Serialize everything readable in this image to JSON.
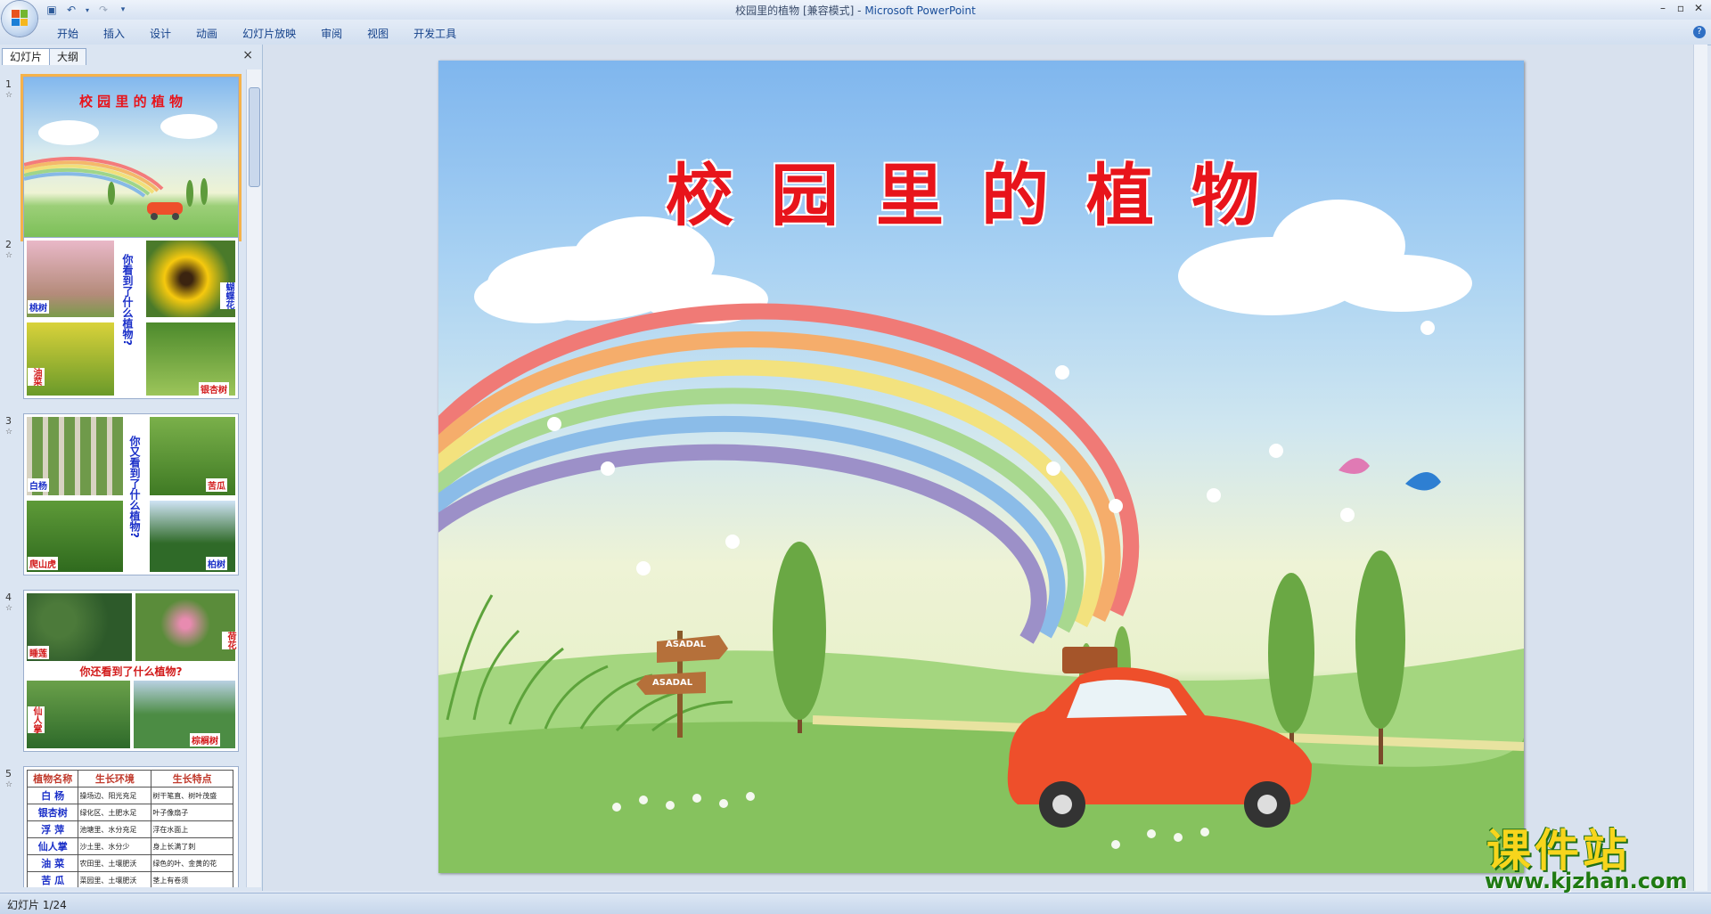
{
  "window": {
    "title": "校园里的植物 [兼容模式]",
    "separator": " - ",
    "app_name": "Microsoft PowerPoint"
  },
  "ribbon": {
    "tabs": [
      "开始",
      "插入",
      "设计",
      "动画",
      "幻灯片放映",
      "审阅",
      "视图",
      "开发工具"
    ]
  },
  "panel": {
    "tabs": [
      "幻灯片",
      "大纲"
    ],
    "close": "×"
  },
  "thumbnails": [
    {
      "num": "1",
      "title": "校 园 里 的 植 物"
    },
    {
      "num": "2",
      "question": "你看到了什么植物?",
      "labels": [
        "桃树",
        "蝴蝶花",
        "油菜",
        "银杏树"
      ]
    },
    {
      "num": "3",
      "question": "你又看到了什么植物?",
      "labels": [
        "白杨",
        "苦瓜",
        "爬山虎",
        "柏树"
      ]
    },
    {
      "num": "4",
      "question": "你还看到了什么植物?",
      "labels": [
        "睡莲",
        "荷花",
        "仙人掌",
        "棕榈树"
      ]
    },
    {
      "num": "5",
      "table_headers": [
        "植物名称",
        "生长环境",
        "生长特点"
      ],
      "table_rows": [
        [
          "白 杨",
          "操场边、阳光充足",
          "树干笔直、树叶茂盛"
        ],
        [
          "银杏树",
          "绿化区、土肥水足",
          "叶子像扇子"
        ],
        [
          "浮 萍",
          "池塘里、水分充足",
          "浮在水面上"
        ],
        [
          "仙人掌",
          "沙土里、水分少",
          "身上长满了刺"
        ],
        [
          "油 菜",
          "农田里、土壤肥沃",
          "绿色的叶、金黄的花"
        ],
        [
          "苦 瓜",
          "菜园里、土壤肥沃",
          "茎上有卷须"
        ]
      ]
    }
  ],
  "slide": {
    "title": "校园里的植物",
    "signs": [
      "ASADAL",
      "ASADAL"
    ]
  },
  "watermark": {
    "text": "课件站",
    "url": "www.kjzhan.com"
  },
  "status": {
    "text": "幻灯片 1/24"
  },
  "colors": {
    "title_red": "#e8141b",
    "ribbon_text": "#15428b",
    "selection": "#f5b24a"
  }
}
